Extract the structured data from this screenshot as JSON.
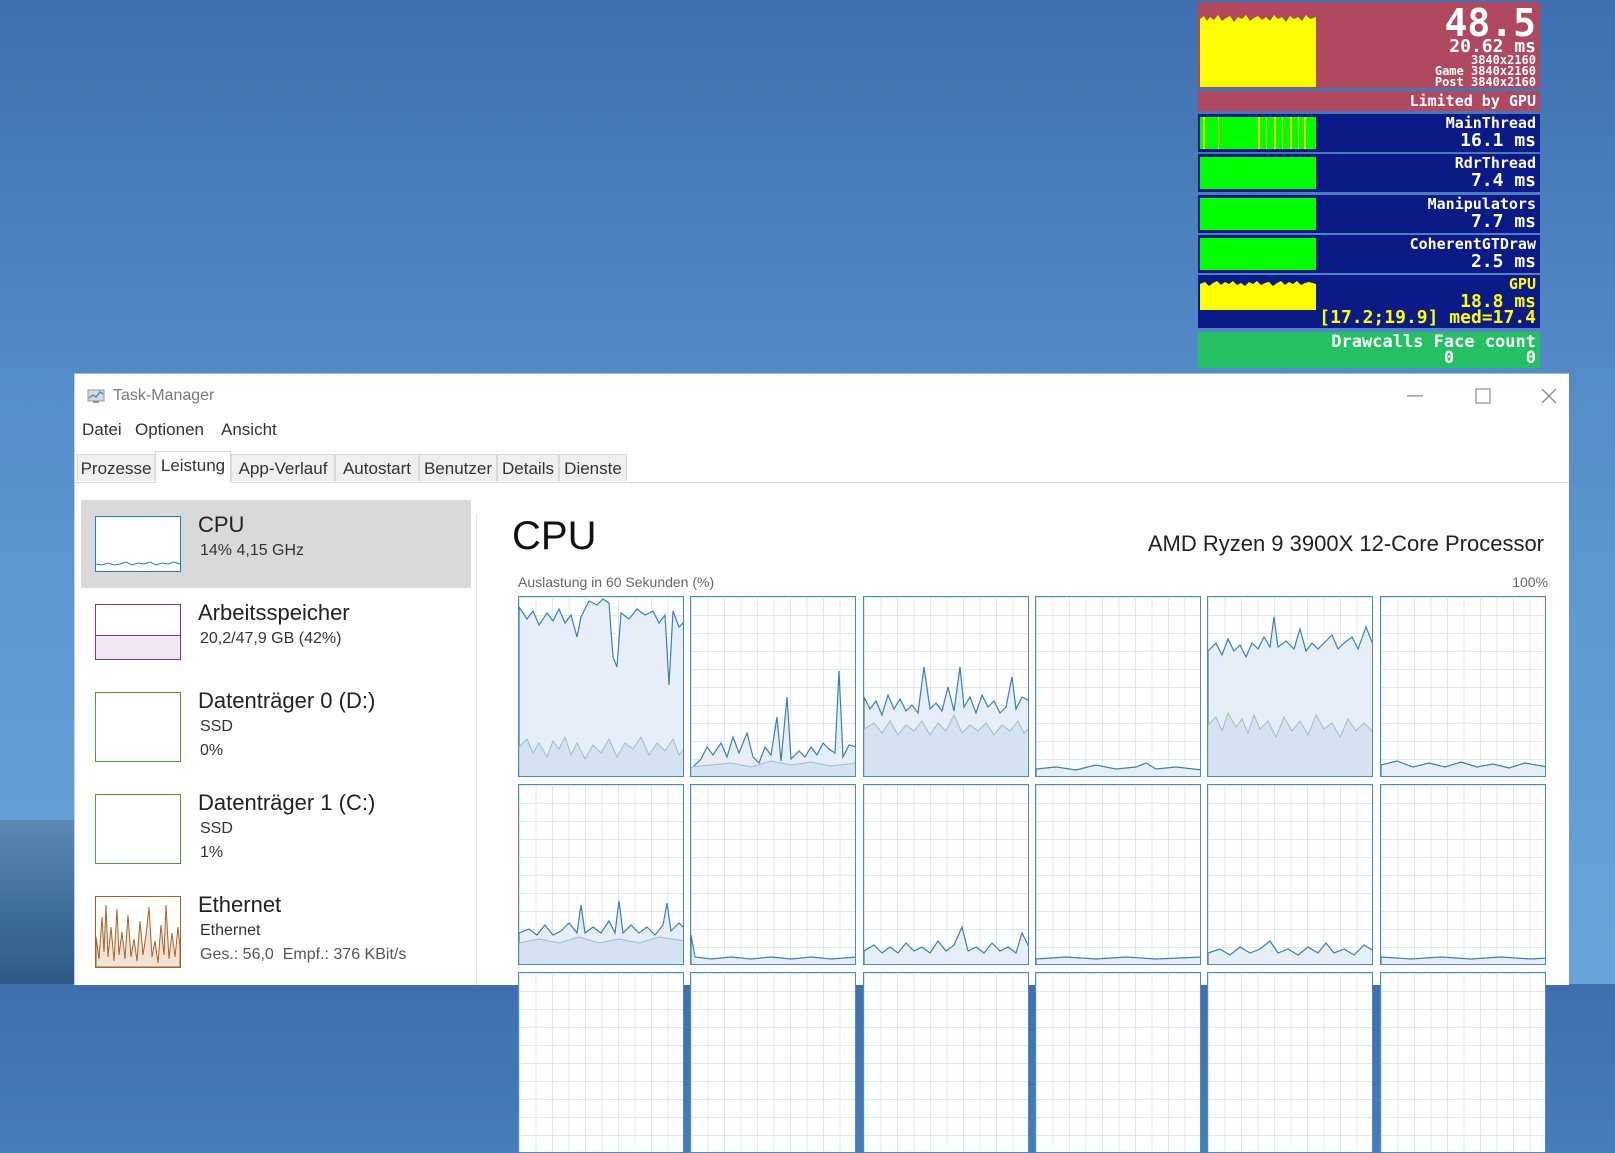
{
  "overlay": {
    "fps": "48.5",
    "frame_ms": "20.62 ms",
    "res_line1": "3840x2160",
    "res_game": "Game 3840x2160",
    "res_post": "Post 3840x2160",
    "limited": "Limited by GPU",
    "threads": [
      {
        "name": "MainThread",
        "value": "16.1 ms"
      },
      {
        "name": "RdrThread",
        "value": "7.4 ms"
      },
      {
        "name": "Manipulators",
        "value": "7.7 ms"
      },
      {
        "name": "CoherentGTDraw",
        "value": "2.5 ms"
      }
    ],
    "gpu": {
      "name": "GPU",
      "value": "18.8 ms",
      "range": "[17.2;19.9] med=17.4"
    },
    "drawcalls": {
      "label": "Drawcalls Face count",
      "values": "0       0"
    },
    "colors": {
      "fps_bg": "#b0485f",
      "thread_bg": "#0a1a86",
      "green": "#00ff00",
      "yellow": "#ffff00",
      "draw_bg": "#25c062"
    }
  },
  "window": {
    "title": "Task-Manager",
    "icon": "task-manager-icon",
    "controls": [
      "minimize-icon",
      "maximize-icon",
      "close-icon"
    ]
  },
  "menu": [
    "Datei",
    "Optionen",
    "Ansicht"
  ],
  "tabs": [
    "Prozesse",
    "Leistung",
    "App-Verlauf",
    "Autostart",
    "Benutzer",
    "Details",
    "Dienste"
  ],
  "active_tab": "Leistung",
  "sidebar": [
    {
      "name": "CPU",
      "sub1": "14%  4,15 GHz",
      "color": "#1a7fbf",
      "selected": true
    },
    {
      "name": "Arbeitsspeicher",
      "sub1": "20,2/47,9 GB (42%)",
      "color": "#8b2f9c"
    },
    {
      "name": "Datenträger 0 (D:)",
      "sub1": "SSD",
      "sub2": "0%",
      "color": "#4ea02a"
    },
    {
      "name": "Datenträger 1 (C:)",
      "sub1": "SSD",
      "sub2": "1%",
      "color": "#4ea02a"
    },
    {
      "name": "Ethernet",
      "sub1": "Ethernet",
      "sub2_a": "Ges.: 56,0",
      "sub2_b": "Empf.: 376 KBit/s",
      "color": "#a7622a"
    }
  ],
  "main": {
    "title": "CPU",
    "processor": "AMD Ryzen 9 3900X 12-Core Processor",
    "axis_label": "Auslastung in 60 Sekunden (%)",
    "axis_max": "100%",
    "core_graph_color": "#4a8bbf",
    "cores_load_hint": [
      85,
      20,
      45,
      2,
      65,
      4,
      18,
      3,
      8,
      2,
      6,
      3
    ]
  }
}
